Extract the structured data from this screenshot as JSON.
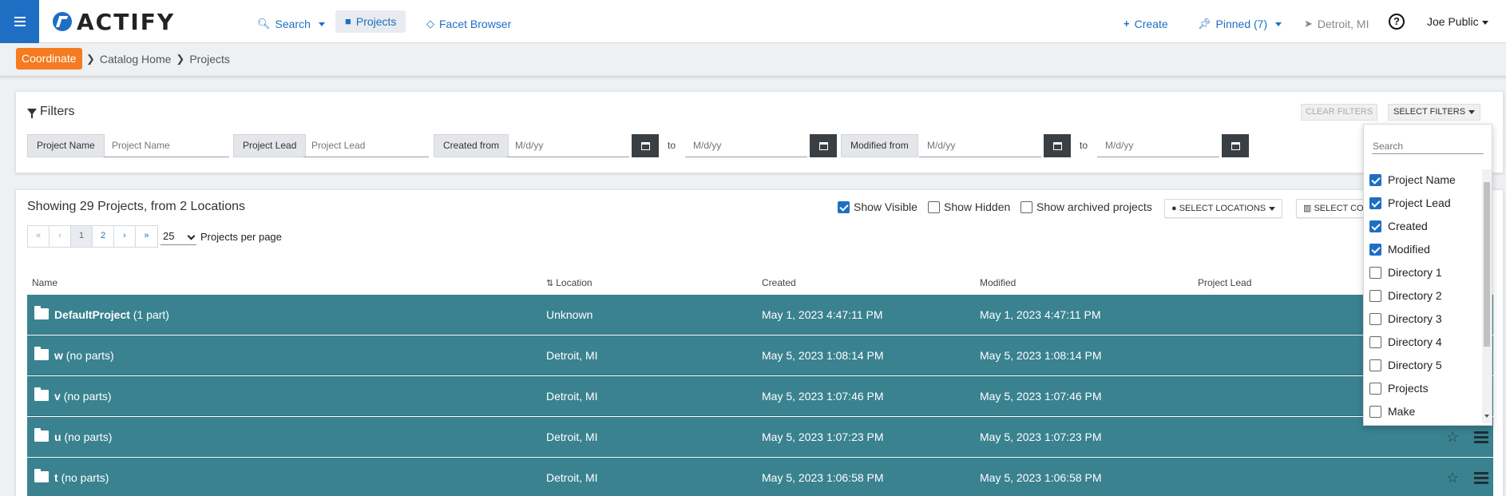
{
  "app": {
    "logo_text": "ACTIFY"
  },
  "nav": {
    "search": "Search",
    "projects": "Projects",
    "facet_browser": "Facet Browser",
    "create": "Create",
    "pinned": "Pinned (7)",
    "location": "Detroit, MI",
    "help": "?",
    "user": "Joe Public"
  },
  "breadcrumb": {
    "coordinate": "Coordinate",
    "catalog_home": "Catalog Home",
    "projects": "Projects"
  },
  "filters": {
    "title": "Filters",
    "clear": "CLEAR FILTERS",
    "select": "SELECT FILTERS",
    "project_name_label": "Project Name",
    "project_name_placeholder": "Project Name",
    "project_lead_label": "Project Lead",
    "project_lead_placeholder": "Project Lead",
    "created_from_label": "Created from",
    "modified_from_label": "Modified from",
    "to": "to",
    "date_placeholder": "M/d/yy"
  },
  "projects": {
    "summary": "Showing 29 Projects, from 2 Locations",
    "show_visible": "Show Visible",
    "show_hidden": "Show Hidden",
    "show_archived": "Show archived projects",
    "select_locations": "SELECT LOCATIONS",
    "select_columns": "SELECT CO",
    "pager": [
      "«",
      "‹",
      "1",
      "2",
      "›",
      "»"
    ],
    "per_page_value": "25",
    "per_page_label": "Projects per page",
    "columns": [
      "Name",
      "Location",
      "Created",
      "Modified",
      "Project Lead"
    ],
    "rows": [
      {
        "name": "DefaultProject",
        "parts": "(1 part)",
        "location": "Unknown",
        "created": "May 1, 2023 4:47:11 PM",
        "modified": "May 1, 2023 4:47:11 PM"
      },
      {
        "name": "w",
        "parts": "(no parts)",
        "location": "Detroit, MI",
        "created": "May 5, 2023 1:08:14 PM",
        "modified": "May 5, 2023 1:08:14 PM"
      },
      {
        "name": "v",
        "parts": "(no parts)",
        "location": "Detroit, MI",
        "created": "May 5, 2023 1:07:46 PM",
        "modified": "May 5, 2023 1:07:46 PM"
      },
      {
        "name": "u",
        "parts": "(no parts)",
        "location": "Detroit, MI",
        "created": "May 5, 2023 1:07:23 PM",
        "modified": "May 5, 2023 1:07:23 PM"
      },
      {
        "name": "t",
        "parts": "(no parts)",
        "location": "Detroit, MI",
        "created": "May 5, 2023 1:06:58 PM",
        "modified": "May 5, 2023 1:06:58 PM"
      }
    ]
  },
  "dropdown": {
    "search_placeholder": "Search",
    "items": [
      {
        "label": "Project Name",
        "checked": true
      },
      {
        "label": "Project Lead",
        "checked": true
      },
      {
        "label": "Created",
        "checked": true
      },
      {
        "label": "Modified",
        "checked": true
      },
      {
        "label": "Directory 1",
        "checked": false
      },
      {
        "label": "Directory 2",
        "checked": false
      },
      {
        "label": "Directory 3",
        "checked": false
      },
      {
        "label": "Directory 4",
        "checked": false
      },
      {
        "label": "Directory 5",
        "checked": false
      },
      {
        "label": "Projects",
        "checked": false
      },
      {
        "label": "Make",
        "checked": false
      }
    ]
  },
  "colors": {
    "primary": "#1e6fc4",
    "accent": "#f47b20",
    "row": "#3a8290"
  }
}
